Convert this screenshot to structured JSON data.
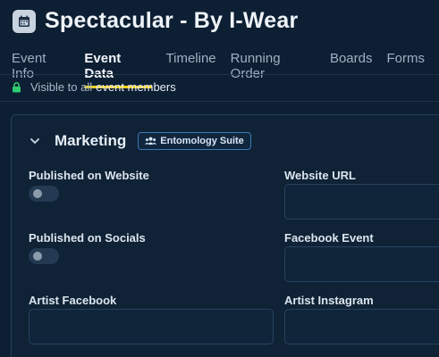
{
  "header": {
    "title": "Spectacular - By I-Wear",
    "icon": "calendar-icon"
  },
  "tabs": [
    {
      "label": "Event Info",
      "active": false
    },
    {
      "label": "Event Data",
      "active": true
    },
    {
      "label": "Timeline",
      "active": false
    },
    {
      "label": "Running Order",
      "active": false
    },
    {
      "label": "Boards",
      "active": false
    },
    {
      "label": "Forms",
      "active": false
    }
  ],
  "visibility": {
    "prefix": "Visible to all",
    "strong": "event members",
    "icon": "lock-icon",
    "icon_color": "#2ecc71"
  },
  "section": {
    "title": "Marketing",
    "badge": {
      "label": "Entomology Suite",
      "icon": "people-icon"
    },
    "fields": {
      "published_website": {
        "label": "Published on Website",
        "checked": false
      },
      "website_url": {
        "label": "Website URL",
        "value": ""
      },
      "published_socials": {
        "label": "Published on Socials",
        "checked": false
      },
      "facebook_event": {
        "label": "Facebook Event",
        "value": ""
      },
      "artist_facebook": {
        "label": "Artist Facebook",
        "value": ""
      },
      "artist_instagram": {
        "label": "Artist Instagram",
        "value": ""
      }
    }
  },
  "colors": {
    "background": "#0d1f33",
    "accent": "#f2d21b",
    "badge_border": "#3d79b8"
  }
}
